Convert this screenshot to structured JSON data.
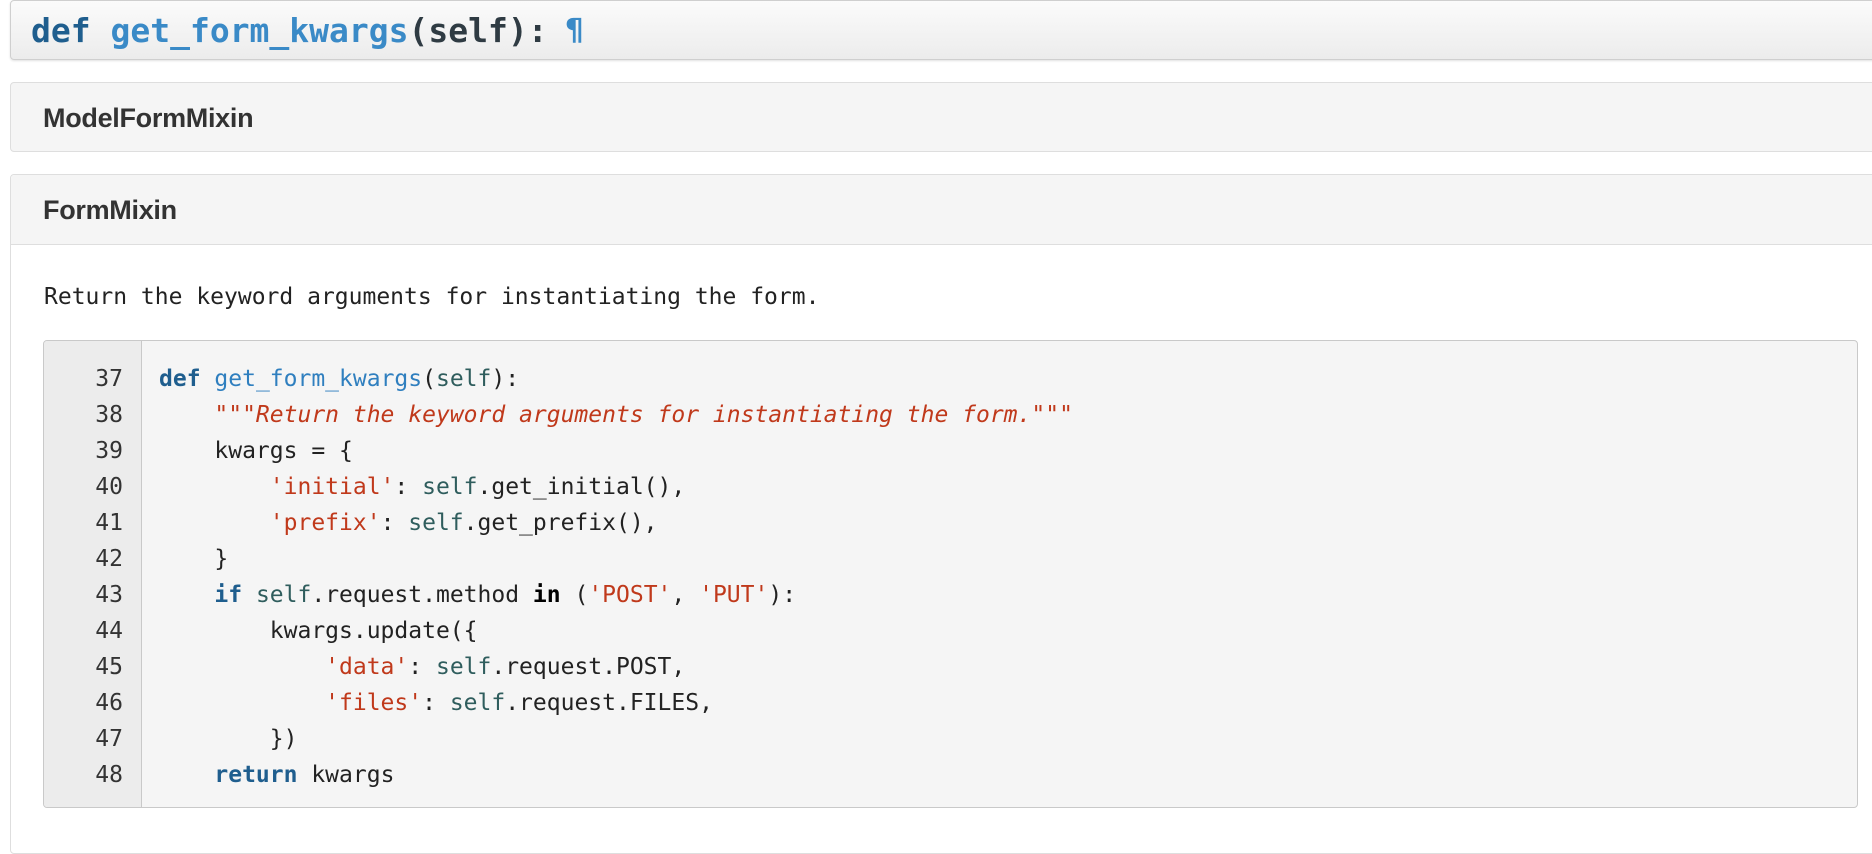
{
  "method_header": {
    "keyword": "def",
    "name": "get_form_kwargs",
    "signature_rest": "(self):",
    "pilcrow": "¶"
  },
  "sections": {
    "model_form_mixin": "ModelFormMixin",
    "form_mixin": "FormMixin"
  },
  "docstring": "Return the keyword arguments for instantiating the form.",
  "code": {
    "line_numbers": [
      "37",
      "38",
      "39",
      "40",
      "41",
      "42",
      "43",
      "44",
      "45",
      "46",
      "47",
      "48"
    ],
    "lines": [
      [
        {
          "t": "kw",
          "v": "def"
        },
        {
          "t": "p",
          "v": " "
        },
        {
          "t": "fn",
          "v": "get_form_kwargs"
        },
        {
          "t": "p",
          "v": "("
        },
        {
          "t": "self",
          "v": "self"
        },
        {
          "t": "p",
          "v": "):"
        }
      ],
      [
        {
          "t": "p",
          "v": "    "
        },
        {
          "t": "doc",
          "v": "\"\"\"Return the keyword arguments for instantiating the form.\"\"\""
        }
      ],
      [
        {
          "t": "p",
          "v": "    kwargs = {"
        }
      ],
      [
        {
          "t": "p",
          "v": "        "
        },
        {
          "t": "str",
          "v": "'initial'"
        },
        {
          "t": "p",
          "v": ": "
        },
        {
          "t": "self",
          "v": "self"
        },
        {
          "t": "p",
          "v": ".get_initial(),"
        }
      ],
      [
        {
          "t": "p",
          "v": "        "
        },
        {
          "t": "str",
          "v": "'prefix'"
        },
        {
          "t": "p",
          "v": ": "
        },
        {
          "t": "self",
          "v": "self"
        },
        {
          "t": "p",
          "v": ".get_prefix(),"
        }
      ],
      [
        {
          "t": "p",
          "v": "    }"
        }
      ],
      [
        {
          "t": "p",
          "v": "    "
        },
        {
          "t": "kw",
          "v": "if"
        },
        {
          "t": "p",
          "v": " "
        },
        {
          "t": "self",
          "v": "self"
        },
        {
          "t": "p",
          "v": ".request.method "
        },
        {
          "t": "kw2",
          "v": "in"
        },
        {
          "t": "p",
          "v": " ("
        },
        {
          "t": "str",
          "v": "'POST'"
        },
        {
          "t": "p",
          "v": ", "
        },
        {
          "t": "str",
          "v": "'PUT'"
        },
        {
          "t": "p",
          "v": "):"
        }
      ],
      [
        {
          "t": "p",
          "v": "        kwargs.update({"
        }
      ],
      [
        {
          "t": "p",
          "v": "            "
        },
        {
          "t": "str",
          "v": "'data'"
        },
        {
          "t": "p",
          "v": ": "
        },
        {
          "t": "self",
          "v": "self"
        },
        {
          "t": "p",
          "v": ".request.POST,"
        }
      ],
      [
        {
          "t": "p",
          "v": "            "
        },
        {
          "t": "str",
          "v": "'files'"
        },
        {
          "t": "p",
          "v": ": "
        },
        {
          "t": "self",
          "v": "self"
        },
        {
          "t": "p",
          "v": ".request.FILES,"
        }
      ],
      [
        {
          "t": "p",
          "v": "        })"
        }
      ],
      [
        {
          "t": "p",
          "v": "    "
        },
        {
          "t": "kw",
          "v": "return"
        },
        {
          "t": "p",
          "v": " kwargs"
        }
      ]
    ]
  },
  "colors": {
    "keyword": "#1f5e8e",
    "function_name": "#2f7fbf",
    "string": "#c0391b",
    "self": "#2f5d5d"
  }
}
